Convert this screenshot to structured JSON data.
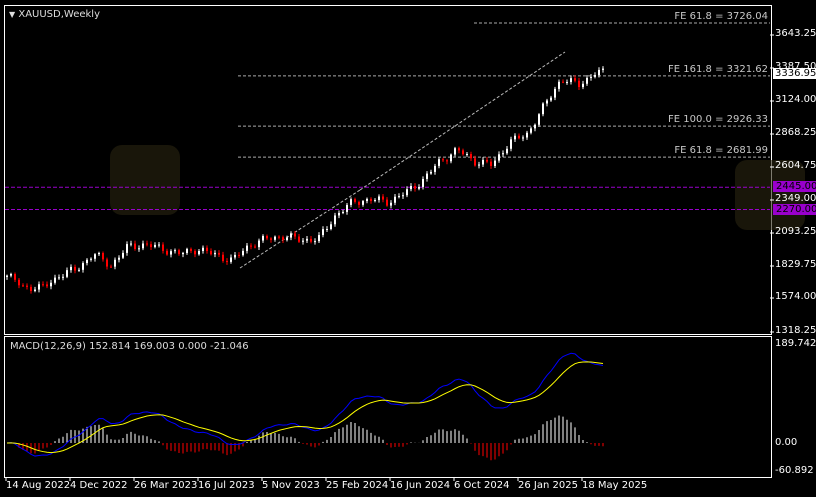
{
  "chart_title": "XAUUSD,Weekly",
  "current_price": "3336.95",
  "price_axis": [
    "3643.25",
    "3387.50",
    "3124.00",
    "2868.25",
    "2604.75",
    "2349.00",
    "2093.25",
    "1829.75",
    "1574.00",
    "1318.25"
  ],
  "fibo_levels": [
    {
      "label": "FE 61.8 = 3726.04",
      "price": 3726.04
    },
    {
      "label": "FE 161.8 = 3321.62",
      "price": 3321.62
    },
    {
      "label": "FE 100.0 = 2926.33",
      "price": 2926.33
    },
    {
      "label": "FE 61.8 = 2681.99",
      "price": 2681.99
    }
  ],
  "hlines": [
    {
      "label": "2445.00",
      "price": 2445.0,
      "color": "#9900cc"
    },
    {
      "label": "2270.00",
      "price": 2270.0,
      "color": "#9900cc"
    }
  ],
  "macd": {
    "label": "MACD(12,26,9) 152.814 169.003 0.000 -21.046",
    "axis": [
      "189.742",
      "0.00",
      "-60.892"
    ],
    "macd_color": "#0000ff",
    "signal_color": "#ffff00",
    "hist_up": "#ffffff",
    "hist_down": "#ff0000"
  },
  "time_axis": [
    "14 Aug 2022",
    "4 Dec 2022",
    "26 Mar 2023",
    "16 Jul 2023",
    "5 Nov 2023",
    "25 Feb 2024",
    "16 Jun 2024",
    "6 Oct 2024",
    "26 Jan 2025",
    "18 May 2025"
  ],
  "chart_data": {
    "type": "candlestick",
    "title": "XAUUSD,Weekly",
    "monthly_closes": [
      1750,
      1660,
      1650,
      1750,
      1800,
      1920,
      1830,
      1980,
      1995,
      1960,
      1920,
      1960,
      1915,
      1870,
      1990,
      2040,
      2060,
      2030,
      2040,
      2230,
      2330,
      2350,
      2330,
      2400,
      2500,
      2650,
      2740,
      2650,
      2620,
      2800,
      2860,
      3080,
      3300,
      3250,
      3350,
      3340
    ],
    "ylim": [
      1318.25,
      3726.04
    ]
  }
}
